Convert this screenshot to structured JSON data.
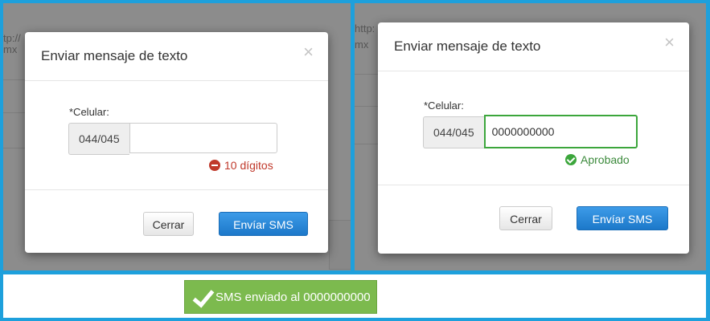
{
  "background": {
    "url_fragment_left": "tp://",
    "url_fragment_left2": "mx",
    "url_fragment_right": "http:",
    "url_fragment_right2": "mx"
  },
  "dialog_left": {
    "title": "Enviar mensaje de texto",
    "close_glyph": "×",
    "phone_label": "*Celular:",
    "prefix": "044/045",
    "phone_value": "",
    "validation_text": "10 dígitos",
    "validation_state": "error",
    "cancel_label": "Cerrar",
    "send_label": "Envíar SMS"
  },
  "dialog_right": {
    "title": "Enviar mensaje de texto",
    "close_glyph": "×",
    "phone_label": "*Celular:",
    "prefix": "044/045",
    "phone_value": "0000000000",
    "validation_text": "Aprobado",
    "validation_state": "ok",
    "cancel_label": "Cerrar",
    "send_label": "Envíar SMS"
  },
  "toast": {
    "message": "SMS enviado al 0000000000",
    "icon": "check-icon",
    "color": "#7cba4e"
  },
  "colors": {
    "primary": "#1c78c9",
    "error": "#c0392b",
    "success": "#3ca63c",
    "frame": "#1ea0dc"
  }
}
